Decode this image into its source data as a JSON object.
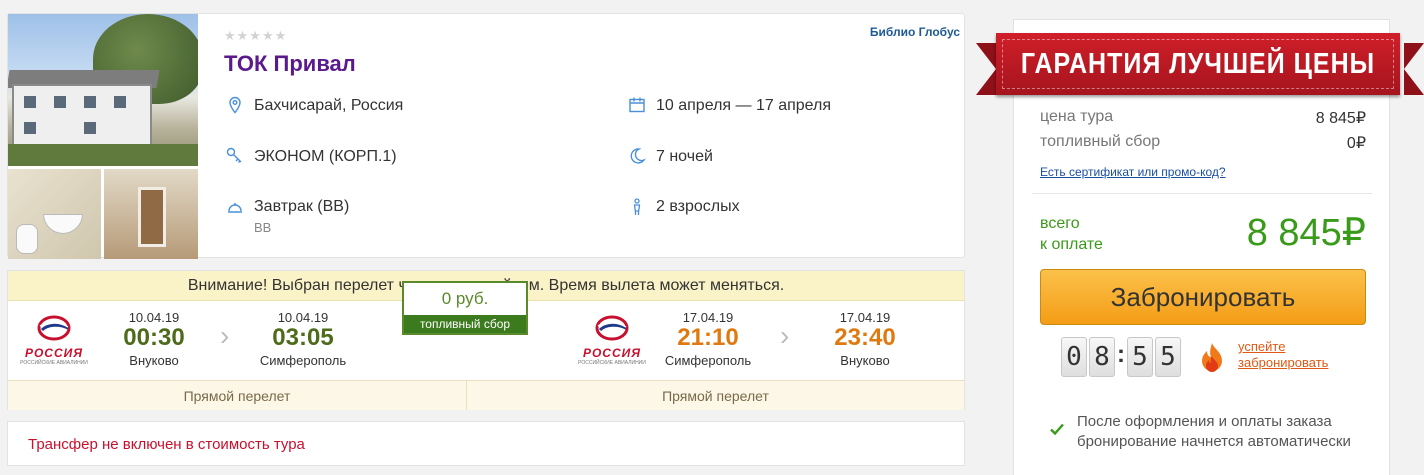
{
  "hotel": {
    "stars": "★★★★★",
    "operator": "Библио Глобус",
    "name": "ТОК Привал",
    "location": "Бахчисарай, Россия",
    "room": "ЭКОНОМ (КОРП.1)",
    "meal": "Завтрак (BB)",
    "meal_code": "BB",
    "dates": "10 апреля — 17 апреля",
    "nights": "7 ночей",
    "guests": "2 взрослых",
    "icons": {
      "location": "map-pin-icon",
      "room": "key-icon",
      "meal": "cloche-icon",
      "dates": "calendar-icon",
      "nights": "moon-icon",
      "guests": "person-icon"
    }
  },
  "flights": {
    "warning": "Внимание! Выбран перелет чартерным рейсом. Время вылета может меняться.",
    "airline": "РОССИЯ",
    "airline_sub": "РОССИЙСКИЕ АВИАЛИНИИ",
    "outbound": {
      "dep_date": "10.04.19",
      "dep_time": "00:30",
      "dep_city": "Внуково",
      "arr_date": "10.04.19",
      "arr_time": "03:05",
      "arr_city": "Симферополь",
      "type": "Прямой перелет"
    },
    "fuel": {
      "value": "0 руб.",
      "label": "топливный сбор"
    },
    "return": {
      "dep_date": "17.04.19",
      "dep_time": "21:10",
      "dep_city": "Симферополь",
      "arr_date": "17.04.19",
      "arr_time": "23:40",
      "arr_city": "Внуково",
      "type": "Прямой перелет"
    },
    "colors": {
      "outbound_time": "#4d6b1a",
      "return_time": "#e07a10"
    }
  },
  "transfer": {
    "text": "Трансфер не включен в стоимость тура"
  },
  "price": {
    "guarantee": "ГАРАНТИЯ ЛУЧШЕЙ ЦЕНЫ",
    "tour_label": "цена тура",
    "tour_value": "8 845₽",
    "fuel_label": "топливный сбор",
    "fuel_value": "0₽",
    "promo_link": "Есть сертификат или промо-код?",
    "total_label_1": "всего",
    "total_label_2": "к оплате",
    "total_value": "8 845₽",
    "book_button": "Забронировать",
    "timer": [
      "0",
      "8",
      "5",
      "5"
    ],
    "timer_separator": ":",
    "hurry_1": "успейте",
    "hurry_2": "забронировать",
    "notice": "После оформления и оплаты заказа бронирование начнется автоматически",
    "accent_color": "#3a9a1a",
    "button_color": "#f4a21e"
  }
}
